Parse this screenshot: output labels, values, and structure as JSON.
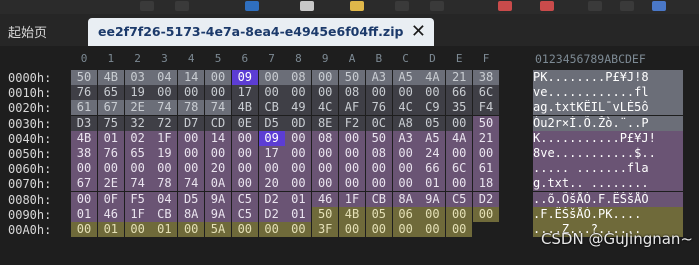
{
  "tabs": {
    "home_label": "起始页",
    "active_label": "ee2f7f26-5173-4e7a-8ea4-e4945e6f04ff.zip",
    "close_glyph": "✕"
  },
  "hex_columns": [
    "0",
    "1",
    "2",
    "3",
    "4",
    "5",
    "6",
    "7",
    "8",
    "9",
    "A",
    "B",
    "C",
    "D",
    "E",
    "F"
  ],
  "ascii_header": "0123456789ABCDEF",
  "rows": [
    {
      "offset": "0000h:",
      "bytes": [
        "50",
        "4B",
        "03",
        "04",
        "14",
        "00",
        "09",
        "00",
        "08",
        "00",
        "50",
        "A3",
        "A5",
        "4A",
        "21",
        "38"
      ],
      "ascii": "PK........P£¥J!8"
    },
    {
      "offset": "0010h:",
      "bytes": [
        "76",
        "65",
        "19",
        "00",
        "00",
        "00",
        "17",
        "00",
        "00",
        "00",
        "08",
        "00",
        "00",
        "00",
        "66",
        "6C"
      ],
      "ascii": "ve............fl"
    },
    {
      "offset": "0020h:",
      "bytes": [
        "61",
        "67",
        "2E",
        "74",
        "78",
        "74",
        "4B",
        "CB",
        "49",
        "4C",
        "AF",
        "76",
        "4C",
        "C9",
        "35",
        "F4"
      ],
      "ascii": "ag.txtKËIL¯vLÉ5ô"
    },
    {
      "offset": "0030h:",
      "bytes": [
        "D3",
        "75",
        "32",
        "72",
        "D7",
        "CD",
        "0E",
        "D5",
        "0D",
        "8E",
        "F2",
        "0C",
        "A8",
        "05",
        "00",
        "50"
      ],
      "ascii": "Óu2r×Í.Õ.Žò.¨..P"
    },
    {
      "offset": "0040h:",
      "bytes": [
        "4B",
        "01",
        "02",
        "1F",
        "00",
        "14",
        "00",
        "09",
        "00",
        "08",
        "00",
        "50",
        "A3",
        "A5",
        "4A",
        "21"
      ],
      "ascii": "K...........P£¥J!"
    },
    {
      "offset": "0050h:",
      "bytes": [
        "38",
        "76",
        "65",
        "19",
        "00",
        "00",
        "00",
        "17",
        "00",
        "00",
        "00",
        "08",
        "00",
        "24",
        "00",
        "00"
      ],
      "ascii": "8ve...........$.."
    },
    {
      "offset": "0060h:",
      "bytes": [
        "00",
        "00",
        "00",
        "00",
        "00",
        "20",
        "00",
        "00",
        "00",
        "00",
        "00",
        "00",
        "00",
        "66",
        "6C",
        "61"
      ],
      "ascii": "..... .......fla"
    },
    {
      "offset": "0070h:",
      "bytes": [
        "67",
        "2E",
        "74",
        "78",
        "74",
        "0A",
        "00",
        "20",
        "00",
        "00",
        "00",
        "00",
        "00",
        "01",
        "00",
        "18"
      ],
      "ascii": "g.txt.. ........"
    },
    {
      "offset": "0080h:",
      "bytes": [
        "00",
        "0F",
        "F5",
        "04",
        "D5",
        "9A",
        "C5",
        "D2",
        "01",
        "46",
        "1F",
        "CB",
        "8A",
        "9A",
        "C5",
        "D2"
      ],
      "ascii": "..õ.ÕšÅÒ.F.ËŠšÅÒ"
    },
    {
      "offset": "0090h:",
      "bytes": [
        "01",
        "46",
        "1F",
        "CB",
        "8A",
        "9A",
        "C5",
        "D2",
        "01",
        "50",
        "4B",
        "05",
        "06",
        "00",
        "00",
        "00"
      ],
      "ascii": ".F.ËŠšÅÒ.PK...."
    },
    {
      "offset": "00A0h:",
      "bytes": [
        "00",
        "01",
        "00",
        "01",
        "00",
        "5A",
        "00",
        "00",
        "00",
        "3F",
        "00",
        "00",
        "00",
        "00",
        "00",
        ""
      ],
      "ascii": "....Z...?......"
    }
  ],
  "watermark": "CSDN @GuJingnan~",
  "colors": {
    "background": "#1e1e1e",
    "header_block": "#6b6e78",
    "central_dir": "#6a5474",
    "end_record": "#6f6a3a",
    "selection": "#5c3dd4",
    "tab_active": "#e9eef3"
  },
  "icons": [
    "toolbar-icons",
    "close-icon"
  ]
}
